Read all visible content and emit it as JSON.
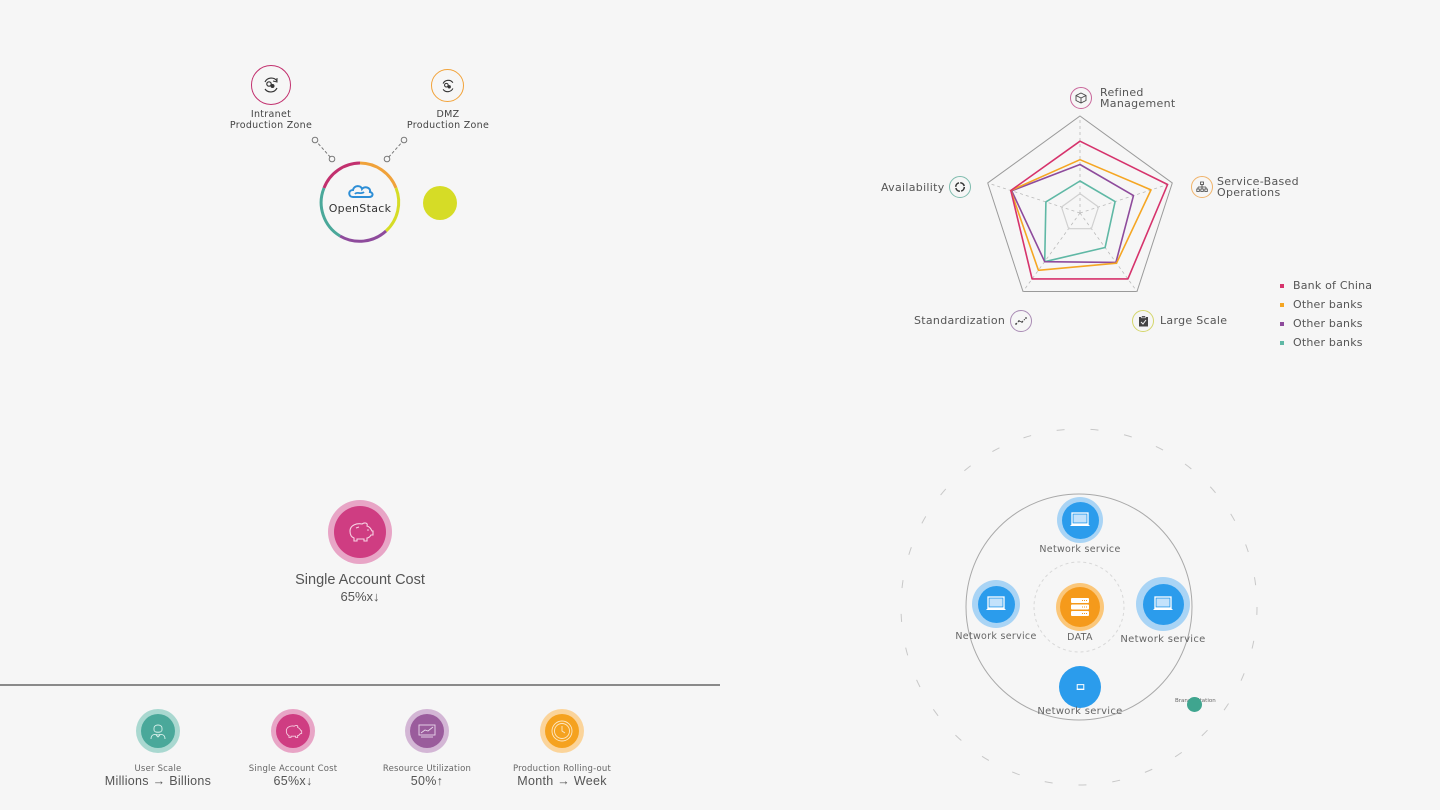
{
  "topology": {
    "zones": [
      {
        "label_line1": "Intranet",
        "label_line2": "Production Zone",
        "icon": "sync-icon",
        "color": "#c2306e"
      },
      {
        "label_line1": "DMZ",
        "label_line2": "Production Zone",
        "icon": "sync-icon",
        "color": "#f2a33a"
      }
    ],
    "hub": {
      "label": "OpenStack",
      "icon": "cloud-icon"
    },
    "satellite_color": "#d6dc26"
  },
  "radar": {
    "axes": [
      {
        "label_line1": "Refined",
        "label_line2": "Management",
        "icon": "cube-icon",
        "color": "#c9679b"
      },
      {
        "label_line1": "Service-Based",
        "label_line2": "Operations",
        "icon": "hierarchy-icon",
        "color": "#f0b36a"
      },
      {
        "label_line1": "Large Scale",
        "label_line2": "",
        "icon": "clipboard-icon",
        "color": "#d4d66a"
      },
      {
        "label_line1": "Standardization",
        "label_line2": "",
        "icon": "trend-icon",
        "color": "#a98bb4"
      },
      {
        "label_line1": "Availability",
        "label_line2": "",
        "icon": "refresh-icon",
        "color": "#7fbcae"
      }
    ]
  },
  "chart_data": {
    "type": "radar",
    "title": "",
    "axes": [
      "Refined Management",
      "Service-Based Operations",
      "Large Scale",
      "Standardization",
      "Availability"
    ],
    "range": [
      0,
      1
    ],
    "series": [
      {
        "name": "Bank of China",
        "color": "#d6336c",
        "values": [
          0.74,
          0.95,
          0.84,
          0.84,
          0.75
        ]
      },
      {
        "name": "Other banks",
        "color": "#f5a623",
        "values": [
          0.55,
          0.77,
          0.64,
          0.73,
          0.75
        ]
      },
      {
        "name": "Other banks",
        "color": "#8e4b9c",
        "values": [
          0.5,
          0.58,
          0.63,
          0.62,
          0.74
        ]
      },
      {
        "name": "Other banks",
        "color": "#5fb8a5",
        "values": [
          0.33,
          0.38,
          0.44,
          0.62,
          0.37
        ]
      }
    ],
    "inner_reference": 0.2,
    "legend_position": "right"
  },
  "highlight_metric": {
    "title": "Single Account Cost",
    "value": "65%x↓",
    "icon": "piggy-bank-icon"
  },
  "metrics": [
    {
      "title": "User Scale",
      "value": "Millions → Billions",
      "icon": "user-icon",
      "inner": "#4aa89a",
      "outer": "#a9d8d0"
    },
    {
      "title": "Single Account Cost",
      "value": "65%x↓",
      "icon": "piggy-bank-icon",
      "inner": "#cf3d82",
      "outer": "#e8a5c6"
    },
    {
      "title": "Resource Utilization",
      "value": "50%↑",
      "icon": "chart-screen-icon",
      "inner": "#9a5c9c",
      "outer": "#d3b6d5"
    },
    {
      "title": "Production Rolling-out",
      "value": "Month → Week",
      "icon": "clock-icon",
      "inner": "#f5a21f",
      "outer": "#fbd49a"
    }
  ],
  "network": {
    "center": {
      "label": "DATA",
      "icon": "server-icon"
    },
    "nodes": [
      {
        "label": "Network service",
        "icon": "laptop-icon"
      },
      {
        "label": "Network service",
        "icon": "laptop-icon"
      },
      {
        "label": "Network service",
        "icon": "laptop-icon"
      },
      {
        "label": "Network service",
        "icon": "laptop-icon"
      }
    ],
    "branch": {
      "label": "Branch Station"
    }
  }
}
